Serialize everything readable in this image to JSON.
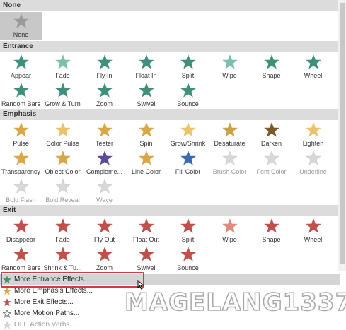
{
  "sections": [
    {
      "name": "None",
      "items": [
        {
          "label": "None",
          "icon": "star-gray-icon",
          "color": "#9a9a9a",
          "selected": true
        }
      ]
    },
    {
      "name": "Entrance",
      "items": [
        {
          "label": "Appear",
          "icon": "star-appear-icon",
          "color": "#3f8f7a"
        },
        {
          "label": "Fade",
          "icon": "star-fade-icon",
          "color": "#7cbfae"
        },
        {
          "label": "Fly In",
          "icon": "star-fly-in-icon",
          "color": "#3f8f7a"
        },
        {
          "label": "Float In",
          "icon": "star-float-in-icon",
          "color": "#3f8f7a"
        },
        {
          "label": "Split",
          "icon": "star-split-icon",
          "color": "#3f8f7a"
        },
        {
          "label": "Wipe",
          "icon": "star-wipe-icon",
          "color": "#7cbfae"
        },
        {
          "label": "Shape",
          "icon": "star-shape-icon",
          "color": "#3f8f7a"
        },
        {
          "label": "Wheel",
          "icon": "star-wheel-icon",
          "color": "#3f8f7a"
        },
        {
          "label": "Random Bars",
          "icon": "star-random-bars-icon",
          "color": "#3f8f7a"
        },
        {
          "label": "Grow & Turn",
          "icon": "star-grow-turn-icon",
          "color": "#3f8f7a"
        },
        {
          "label": "Zoom",
          "icon": "star-zoom-icon",
          "color": "#3f8f7a"
        },
        {
          "label": "Swivel",
          "icon": "star-swivel-icon",
          "color": "#3f8f7a"
        },
        {
          "label": "Bounce",
          "icon": "star-bounce-icon",
          "color": "#3f8f7a"
        }
      ]
    },
    {
      "name": "Emphasis",
      "items": [
        {
          "label": "Pulse",
          "icon": "star-pulse-icon",
          "color": "#d9a648"
        },
        {
          "label": "Color Pulse",
          "icon": "star-color-pulse-icon",
          "color": "#e9c46a"
        },
        {
          "label": "Teeter",
          "icon": "star-teeter-icon",
          "color": "#d9a648"
        },
        {
          "label": "Spin",
          "icon": "star-spin-icon",
          "color": "#d9a648"
        },
        {
          "label": "Grow/Shrink",
          "icon": "star-grow-shrink-icon",
          "color": "#e9c46a"
        },
        {
          "label": "Desaturate",
          "icon": "star-desaturate-icon",
          "color": "#c9a24a"
        },
        {
          "label": "Darken",
          "icon": "star-darken-icon",
          "color": "#7a5a2a"
        },
        {
          "label": "Lighten",
          "icon": "star-lighten-icon",
          "color": "#e9c46a"
        },
        {
          "label": "Transparency",
          "icon": "star-transparency-icon",
          "color": "#d9a648"
        },
        {
          "label": "Object Color",
          "icon": "star-object-color-icon",
          "color": "#d9a648"
        },
        {
          "label": "Compleme...",
          "icon": "star-complementary-icon",
          "color": "#5b4a9a"
        },
        {
          "label": "Line Color",
          "icon": "star-line-color-icon",
          "color": "#d9a648"
        },
        {
          "label": "Fill Color",
          "icon": "star-fill-color-icon",
          "color": "#3a6ab0"
        },
        {
          "label": "Brush Color",
          "icon": "star-brush-color-icon",
          "color": "#c8c8c8",
          "disabled": true
        },
        {
          "label": "Font Color",
          "icon": "star-font-color-icon",
          "color": "#c8c8c8",
          "disabled": true
        },
        {
          "label": "Underline",
          "icon": "star-underline-icon",
          "color": "#c8c8c8",
          "disabled": true
        },
        {
          "label": "Bold Flash",
          "icon": "star-bold-flash-icon",
          "color": "#c8c8c8",
          "disabled": true
        },
        {
          "label": "Bold Reveal",
          "icon": "star-bold-reveal-icon",
          "color": "#c8c8c8",
          "disabled": true
        },
        {
          "label": "Wave",
          "icon": "star-wave-icon",
          "color": "#c8c8c8",
          "disabled": true
        }
      ]
    },
    {
      "name": "Exit",
      "items": [
        {
          "label": "Disappear",
          "icon": "star-disappear-icon",
          "color": "#c0504d"
        },
        {
          "label": "Fade",
          "icon": "star-exit-fade-icon",
          "color": "#c0504d"
        },
        {
          "label": "Fly Out",
          "icon": "star-fly-out-icon",
          "color": "#c0504d"
        },
        {
          "label": "Float Out",
          "icon": "star-float-out-icon",
          "color": "#c0504d"
        },
        {
          "label": "Split",
          "icon": "star-exit-split-icon",
          "color": "#c0504d"
        },
        {
          "label": "Wipe",
          "icon": "star-exit-wipe-icon",
          "color": "#e08a7a"
        },
        {
          "label": "Shape",
          "icon": "star-exit-shape-icon",
          "color": "#c0504d"
        },
        {
          "label": "Wheel",
          "icon": "star-exit-wheel-icon",
          "color": "#c0504d"
        },
        {
          "label": "Random Bars",
          "icon": "star-exit-random-bars-icon",
          "color": "#c0504d"
        },
        {
          "label": "Shrink & Tu...",
          "icon": "star-shrink-turn-icon",
          "color": "#c0504d"
        },
        {
          "label": "Zoom",
          "icon": "star-exit-zoom-icon",
          "color": "#c0504d"
        },
        {
          "label": "Swivel",
          "icon": "star-exit-swivel-icon",
          "color": "#c0504d"
        },
        {
          "label": "Bounce",
          "icon": "star-exit-bounce-icon",
          "color": "#c0504d"
        }
      ]
    }
  ],
  "menu": [
    {
      "label": "More Entrance Effects...",
      "icon": "star-green-small-icon",
      "color": "#3f8f7a",
      "hover": true
    },
    {
      "label": "More Emphasis Effects...",
      "icon": "star-gold-small-icon",
      "color": "#d9a648"
    },
    {
      "label": "More Exit Effects...",
      "icon": "star-red-small-icon",
      "color": "#c0504d"
    },
    {
      "label": "More Motion Paths...",
      "icon": "star-outline-small-icon",
      "color": "#777777"
    },
    {
      "label": "OLE Action Verbs...",
      "icon": "ole-verbs-icon",
      "color": "#bbbbbb",
      "disabled": true
    }
  ],
  "watermark": "MAGELANG1337"
}
